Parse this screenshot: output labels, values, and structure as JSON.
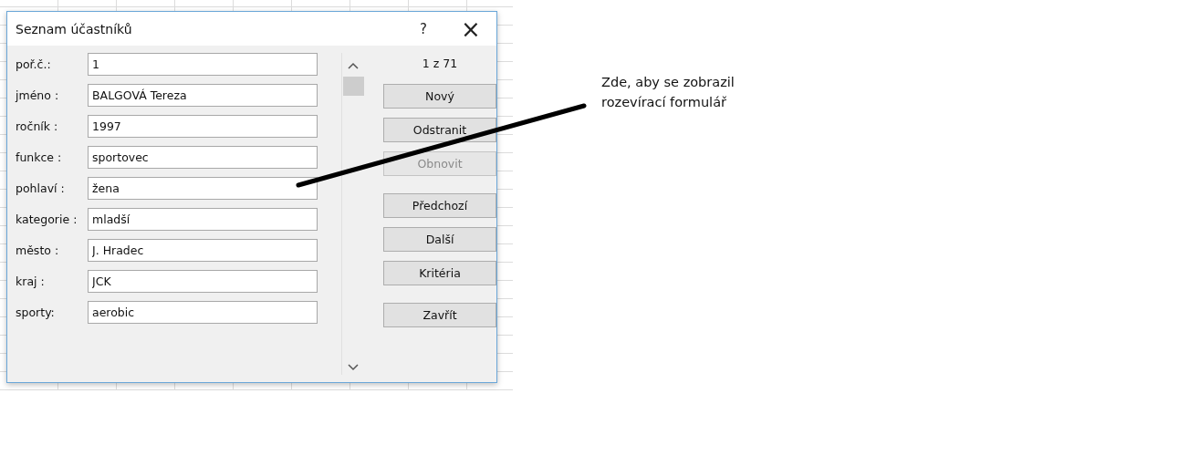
{
  "window": {
    "title": "Seznam účastníků",
    "help": "?",
    "close": "×"
  },
  "fields": [
    {
      "label": "poř.č.:",
      "value": "1"
    },
    {
      "label": "jméno :",
      "value": "BALGOVÁ Tereza"
    },
    {
      "label": "ročník :",
      "value": "1997"
    },
    {
      "label": "funkce :",
      "value": "sportovec"
    },
    {
      "label": "pohlaví :",
      "value": "žena"
    },
    {
      "label": "kategorie :",
      "value": "mladší"
    },
    {
      "label": "město :",
      "value": "J. Hradec"
    },
    {
      "label": "kraj :",
      "value": "JCK"
    },
    {
      "label": "sporty:",
      "value": "aerobic"
    }
  ],
  "record_counter": "1 z 71",
  "button_groups": [
    [
      {
        "label": "Nový",
        "disabled": false
      },
      {
        "label": "Odstranit",
        "disabled": false
      },
      {
        "label": "Obnovit",
        "disabled": true
      }
    ],
    [
      {
        "label": "Předchozí",
        "disabled": false
      },
      {
        "label": "Další",
        "disabled": false
      },
      {
        "label": "Kritéria",
        "disabled": false
      }
    ],
    [
      {
        "label": "Zavřít",
        "disabled": false
      }
    ]
  ],
  "annotation": {
    "lines": [
      "Zde, aby se zobrazil",
      "rozevírací formulář"
    ]
  }
}
